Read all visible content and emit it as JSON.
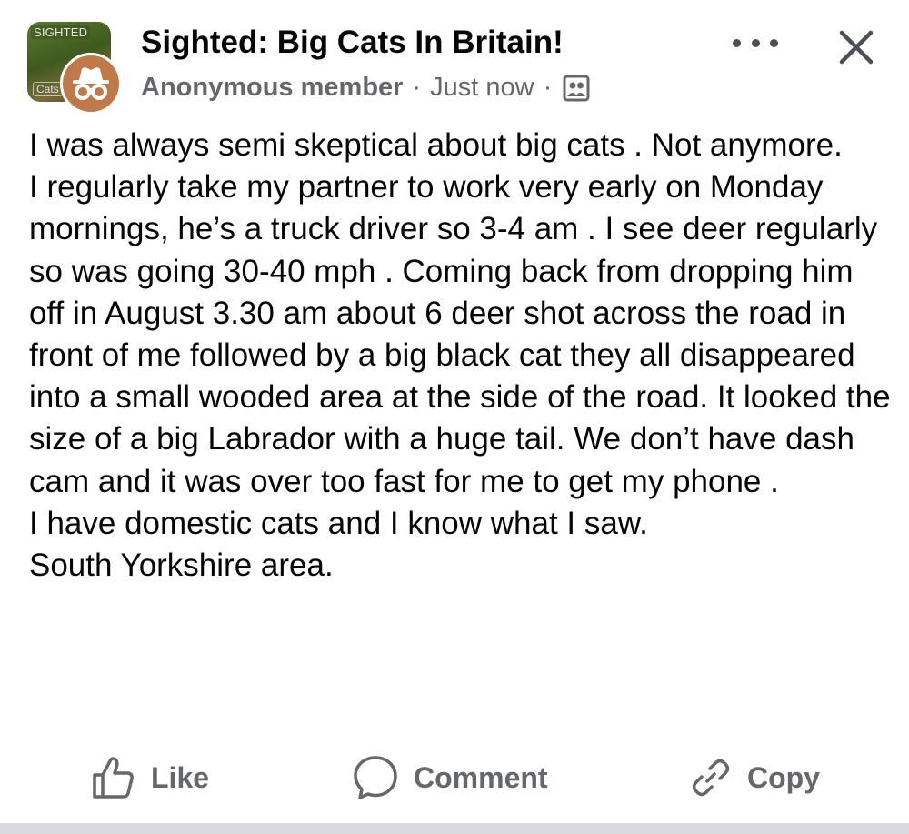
{
  "group": {
    "thumb_tag": "SIGHTED",
    "thumb_tag2": "Cats",
    "name": "Sighted: Big Cats In Britain!"
  },
  "post": {
    "author": "Anonymous member",
    "separator": "·",
    "time": "Just now",
    "privacy_icon": "group-members-icon",
    "body": [
      "I was always semi skeptical about big cats . Not anymore.",
      "I regularly take my partner to work very early on Monday mornings, he’s a truck driver so 3-4 am . I see deer regularly so was going 30-40 mph . Coming back from dropping him off in August 3.30 am about 6 deer shot across the road in front of me followed by a big black cat they all disappeared into a small wooded area at the side of the road. It looked the size of a big Labrador with a huge tail. We don’t have dash cam and it was over too fast for me to get my phone .",
      "I have domestic cats and I know what I saw.",
      "South Yorkshire area."
    ]
  },
  "actions": {
    "like": "Like",
    "comment": "Comment",
    "copy": "Copy"
  },
  "icons": {
    "more": "more-options-icon",
    "close": "close-icon",
    "like": "thumbs-up-icon",
    "comment": "comment-bubble-icon",
    "copy": "link-icon",
    "anon": "anonymous-incognito-icon"
  },
  "colors": {
    "text": "#050505",
    "secondary": "#65676b",
    "anon_avatar": "#c07a4a"
  }
}
